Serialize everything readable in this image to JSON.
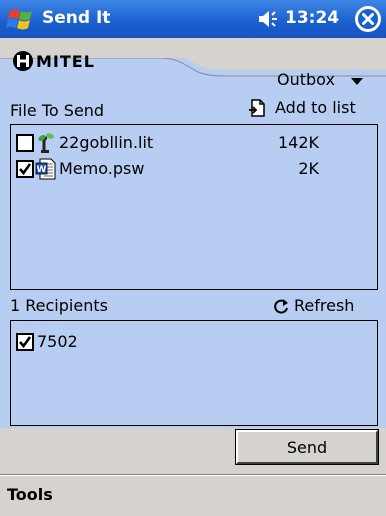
{
  "titlebar": {
    "app_title": "Send It",
    "clock": "13:24"
  },
  "header": {
    "logo_text": "MITEL",
    "folder_select": "Outbox",
    "files_label": "File To Send",
    "add_label": "Add to list"
  },
  "files": [
    {
      "name": "22gobllin.lit",
      "size": "142K",
      "checked": false,
      "icon": "reader-book-icon"
    },
    {
      "name": "Memo.psw",
      "size": "2K",
      "checked": true,
      "icon": "word-doc-icon"
    }
  ],
  "recipients_section": {
    "label": "1 Recipients",
    "refresh_label": "Refresh"
  },
  "recipients": [
    {
      "name": "7502",
      "checked": true
    }
  ],
  "buttons": {
    "send_label": "Send"
  },
  "menubar": {
    "tools_label": "Tools"
  },
  "colors": {
    "titlebar": "#1a5fcf",
    "panel": "#b7cdf2",
    "chrome": "#d6d3ce"
  }
}
